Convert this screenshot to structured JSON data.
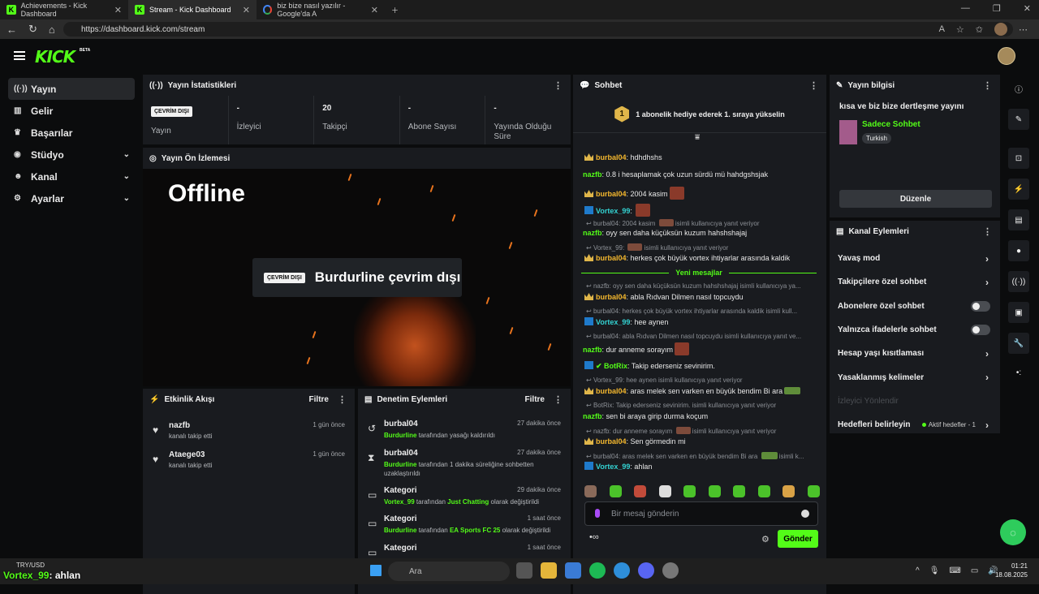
{
  "browser": {
    "tabs": [
      {
        "title": "Achievements - Kick Dashboard"
      },
      {
        "title": "Stream - Kick Dashboard"
      },
      {
        "title": "biz bize nasıl yazılır - Google'da A"
      }
    ],
    "url": "https://dashboard.kick.com/stream"
  },
  "app": {
    "logo": "KICK",
    "beta": "BETA"
  },
  "sidebar": {
    "items": [
      {
        "label": "Yayın",
        "icon": "broadcast-icon"
      },
      {
        "label": "Gelir",
        "icon": "chart-icon"
      },
      {
        "label": "Başarılar",
        "icon": "trophy-icon"
      },
      {
        "label": "Stüdyo",
        "icon": "camera-icon"
      },
      {
        "label": "Kanal",
        "icon": "users-icon"
      },
      {
        "label": "Ayarlar",
        "icon": "gear-icon"
      }
    ]
  },
  "stats": {
    "title": "Yayın İstatistikleri",
    "badge": "ÇEVRİM DIŞI",
    "items": [
      {
        "value": "",
        "label": "Yayın"
      },
      {
        "value": "-",
        "label": "İzleyici"
      },
      {
        "value": "20",
        "label": "Takipçi"
      },
      {
        "value": "-",
        "label": "Abone Sayısı"
      },
      {
        "value": "-",
        "label": "Yayında Olduğu Süre"
      }
    ]
  },
  "preview": {
    "title": "Yayın Ön İzlemesi",
    "offline": "Offline",
    "badge": "ÇEVRİM DIŞI",
    "status": "Burdurline çevrim dışı"
  },
  "activity": {
    "title": "Etkinlik Akışı",
    "filter": "Filtre",
    "items": [
      {
        "name": "nazfb",
        "text": "kanalı takip etti",
        "time": "1 gün önce"
      },
      {
        "name": "Ataege03",
        "text": "kanalı takip etti",
        "time": "1 gün önce"
      }
    ]
  },
  "moderation": {
    "title": "Denetim Eylemleri",
    "filter": "Filtre",
    "items": [
      {
        "name": "burbal04",
        "user": "Burdurline",
        "text": "tarafından yasağı kaldırıldı",
        "time": "27 dakika önce"
      },
      {
        "name": "burbal04",
        "user": "Burdurline",
        "text": "tarafından 1 dakika süreliğine sohbetten uzaklaştırıldı",
        "time": "27 dakika önce"
      },
      {
        "name": "Kategori",
        "user": "Vortex_99",
        "text": "tarafından",
        "cat": "Just Chatting",
        "text2": "olarak değiştirildi",
        "time": "29 dakika önce"
      },
      {
        "name": "Kategori",
        "user": "Burdurline",
        "text": "tarafından",
        "cat": "EA Sports FC 25",
        "text2": "olarak değiştirildi",
        "time": "1 saat önce"
      },
      {
        "name": "Kategori",
        "user": "",
        "text": "",
        "cat": "",
        "text2": "",
        "time": "1 saat önce"
      }
    ]
  },
  "chat": {
    "title": "Sohbet",
    "banner": "1 abonelik hediye ederek 1. sıraya yükselin",
    "banner_num": "1",
    "new_messages": "Yeni mesajlar",
    "placeholder": "Bir mesaj gönderin",
    "send": "Gönder",
    "messages": [
      {
        "user": "burbal04",
        "text": "hdhdhshs"
      },
      {
        "user": "nazfb",
        "text": "0.8 i hesaplamak çok uzun sürdü mü hahdgshsjak"
      },
      {
        "user": "burbal04",
        "text": "2004 kasim"
      },
      {
        "user": "Vortex_99",
        "text": ""
      },
      {
        "reply": "burbal04: 2004 kasim",
        "reply_suffix": "isimli kullanıcıya yanıt veriyor"
      },
      {
        "user": "nazfb",
        "text": "oyy sen daha küçüksün kuzum hahshshajaj"
      },
      {
        "reply": "Vortex_99:",
        "reply_suffix": "isimli kullanıcıya yanıt veriyor"
      },
      {
        "user": "burbal04",
        "text": "herkes çok büyük vortex ihtiyarlar arasında kaldik"
      },
      {
        "reply": "nazfb: oyy sen daha küçüksün kuzum hahshshajaj isimli kullanıcıya ya..."
      },
      {
        "user": "burbal04",
        "text": "abla Rıdvan Dilmen nasıl topcuydu"
      },
      {
        "reply": "burbal04: herkes çok büyük vortex ihtiyarlar arasında kaldik isimli kull..."
      },
      {
        "user": "Vortex_99",
        "text": "hee aynen"
      },
      {
        "reply": "burbal04: abla Rıdvan Dilmen nasıl topcuydu isimli kullanıcıya yanıt ve..."
      },
      {
        "user": "nazfb",
        "text": "dur anneme sorayım"
      },
      {
        "user": "BotRix",
        "text": "Takip ederseniz sevinirim."
      },
      {
        "reply": "Vortex_99: hee aynen isimli kullanıcıya yanıt veriyor"
      },
      {
        "user": "burbal04",
        "text": "aras melek sen varken en büyük bendim Bi ara"
      },
      {
        "reply": "BotRix: Takip ederseniz sevinirim. isimli kullanıcıya yanıt veriyor"
      },
      {
        "user": "nazfb",
        "text": "sen bi araya girip durma koçum"
      },
      {
        "reply": "nazfb: dur anneme sorayım",
        "reply_suffix": "isimli kullanıcıya yanıt veriyor"
      },
      {
        "user": "burbal04",
        "text": "Sen görmedin mi"
      },
      {
        "reply": "burbal04: aras melek sen varken en büyük bendim Bi ara",
        "reply_suffix": "isimli k..."
      },
      {
        "user": "Vortex_99",
        "text": "ahlan"
      }
    ]
  },
  "info": {
    "title": "Yayın bilgisi",
    "stream_title": "kısa ve biz bize dertleşme yayını",
    "category": "Sadece Sohbet",
    "tag": "Turkish",
    "edit": "Düzenle"
  },
  "actions": {
    "title": "Kanal Eylemleri",
    "items": [
      {
        "label": "Yavaş mod",
        "type": "arrow"
      },
      {
        "label": "Takipçilere özel sohbet",
        "type": "arrow"
      },
      {
        "label": "Abonelere özel sohbet",
        "type": "toggle"
      },
      {
        "label": "Yalnızca ifadelerle sohbet",
        "type": "toggle"
      },
      {
        "label": "Hesap yaşı kısıtlaması",
        "type": "arrow"
      },
      {
        "label": "Yasaklanmış kelimeler",
        "type": "arrow"
      },
      {
        "label": "İzleyici Yönlendir",
        "type": "disabled"
      },
      {
        "label": "Hedefleri belirleyin",
        "type": "arrow",
        "sub": "Aktif hedefler - 1"
      }
    ]
  },
  "taskbar": {
    "search": "Ara",
    "weather": "TRY/USD",
    "time": "01:21",
    "date": "18.08.2025"
  },
  "overlay": {
    "user": "Vortex_99",
    "text": ": ahlan"
  },
  "colors": {
    "accent": "#53fc18",
    "panel": "#191b1f",
    "bg": "#0b0c0d"
  }
}
